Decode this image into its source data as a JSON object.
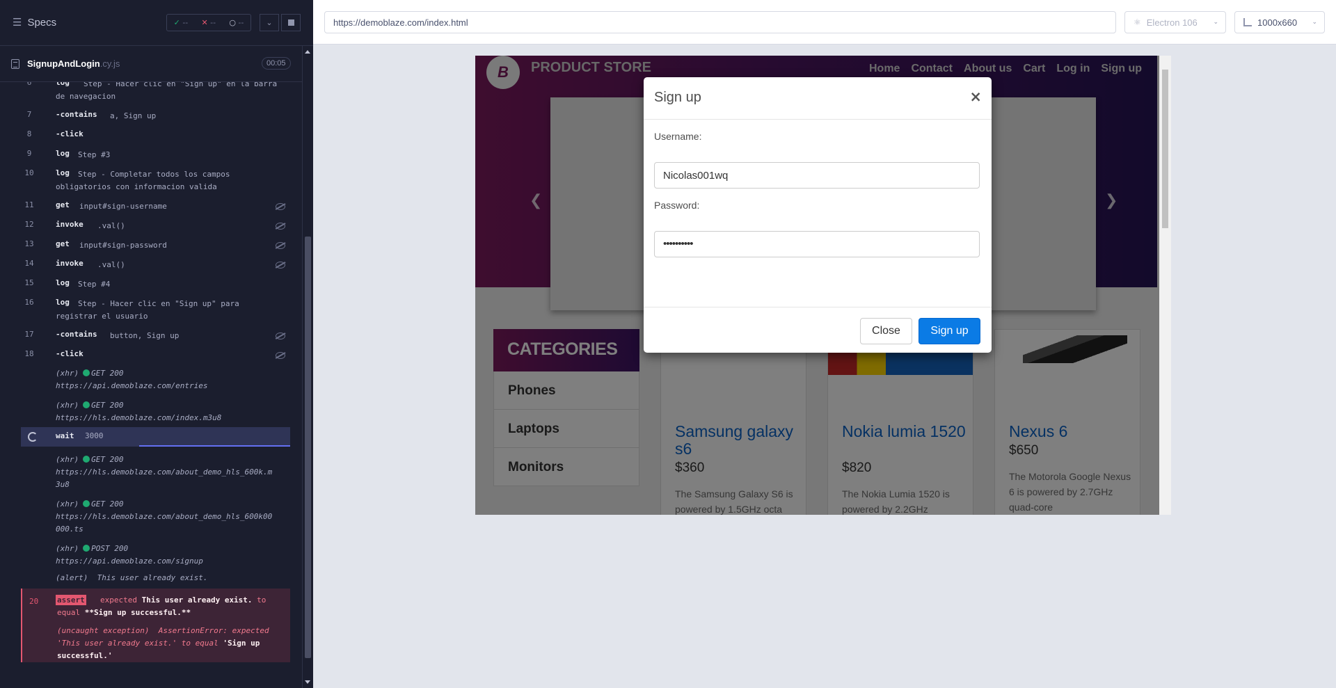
{
  "reporter": {
    "title": "Specs",
    "stats": {
      "passed": "--",
      "failed": "--",
      "pending": "--"
    },
    "spec_file": {
      "name": "SignupAndLogin",
      "ext": ".cy.js",
      "duration": "00:05"
    },
    "commands": [
      {
        "num": "6",
        "name": "log",
        "message": "Step - Hacer clic en \"Sign up\" en la barra\nde navegacion"
      },
      {
        "num": "7",
        "name": "-contains",
        "message": "a, Sign up"
      },
      {
        "num": "8",
        "name": "-click",
        "message": ""
      },
      {
        "num": "9",
        "name": "log",
        "message": "Step #3"
      },
      {
        "num": "10",
        "name": "log",
        "message": "Step - Completar todos los campos\nobligatorios con informacion valida"
      },
      {
        "num": "11",
        "name": "get",
        "message": "input#sign-username"
      },
      {
        "num": "12",
        "name": "invoke",
        "message": ".val()"
      },
      {
        "num": "13",
        "name": "get",
        "message": "input#sign-password"
      },
      {
        "num": "14",
        "name": "invoke",
        "message": ".val()"
      },
      {
        "num": "15",
        "name": "log",
        "message": "Step #4"
      },
      {
        "num": "16",
        "name": "log",
        "message": "Step - Hacer clic en \"Sign up\" para\nregistrar el usuario"
      },
      {
        "num": "17",
        "name": "-contains",
        "message": "button, Sign up"
      },
      {
        "num": "18",
        "name": "-click",
        "message": ""
      }
    ],
    "xhr1": {
      "tag": "(xhr)",
      "status": "GET 200",
      "url": "https://api.demoblaze.com/entries"
    },
    "xhr2": {
      "tag": "(xhr)",
      "status": "GET 200",
      "url": "https://hls.demoblaze.com/index.m3u8"
    },
    "wait": {
      "name": "wait",
      "value": "3000"
    },
    "xhr3": {
      "tag": "(xhr)",
      "status": "GET 200",
      "url_line1": "https://hls.demoblaze.com/about_demo_hls_600k.m",
      "url_line2": "3u8"
    },
    "xhr4": {
      "tag": "(xhr)",
      "status": "GET 200",
      "url_line1": "https://hls.demoblaze.com/about_demo_hls_600k00",
      "url_line2": "000.ts"
    },
    "xhr5": {
      "tag": "(xhr)",
      "status": "POST 200",
      "url": "https://api.demoblaze.com/signup"
    },
    "alert": {
      "tag": "(alert)",
      "text": "This user already exist."
    },
    "error": {
      "num": "20",
      "badge": "assert",
      "l1_pre": "expected ",
      "l1_bold": "This user already exist.",
      "l1_post": " to",
      "l2_pre": "equal ",
      "l2_bold": "**Sign up successful.**",
      "ex_l1": "(uncaught exception)  AssertionError: expected",
      "ex_l2": "'This user already exist.' to equal ",
      "ex_l2_bold": "'Sign up",
      "ex_l3_bold": "successful.'"
    }
  },
  "topbar": {
    "url": "https://demoblaze.com/index.html",
    "browser": "Electron 106",
    "viewport": "1000x660"
  },
  "aut": {
    "brand": "PRODUCT STORE",
    "logo_letter": "B",
    "nav": [
      "Home",
      "Contact",
      "About us",
      "Cart",
      "Log in",
      "Sign up"
    ],
    "categories_title": "CATEGORIES",
    "categories": [
      "Phones",
      "Laptops",
      "Monitors"
    ],
    "products": [
      {
        "title": "Samsung galaxy s6",
        "price": "$360",
        "desc": "The Samsung Galaxy S6 is powered by 1.5GHz octa"
      },
      {
        "title": "Nokia lumia 1520",
        "price": "$820",
        "desc": "The Nokia Lumia 1520 is powered by 2.2GHz"
      },
      {
        "title": "Nexus 6",
        "price": "$650",
        "desc": "The Motorola Google Nexus 6 is powered by 2.7GHz quad-core"
      }
    ],
    "modal": {
      "title": "Sign up",
      "username_label": "Username:",
      "username_value": "Nicolas001wq",
      "password_label": "Password:",
      "password_value": "••••••••••",
      "close_label": "Close",
      "signup_label": "Sign up"
    }
  }
}
